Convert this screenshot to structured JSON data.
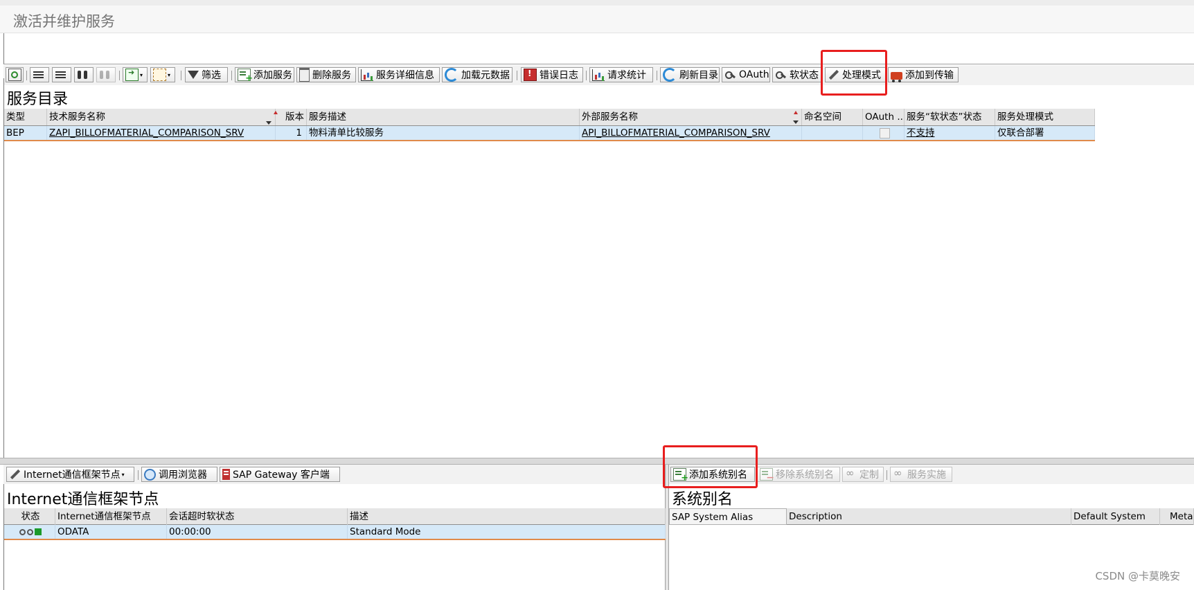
{
  "window": {
    "title": "激活并维护服务"
  },
  "toolbar": {
    "filter": "筛选",
    "add_service": "添加服务",
    "delete_service": "删除服务",
    "service_details": "服务详细信息",
    "load_metadata": "加载元数据",
    "error_log": "错误日志",
    "request_stats": "请求统计",
    "refresh_catalog": "刷新目录",
    "oauth": "OAuth",
    "soft_state": "软状态",
    "processing_mode": "处理模式",
    "add_to_transport": "添加到传输"
  },
  "catalog": {
    "title": "服务目录",
    "columns": [
      "类型",
      "技术服务名称",
      "版本",
      "服务描述",
      "外部服务名称",
      "命名空间",
      "OAuth ...",
      "服务“软状态”状态",
      "服务处理模式"
    ],
    "rows": [
      {
        "type": "BEP",
        "tech_name": "ZAPI_BILLOFMATERIAL_COMPARISON_SRV",
        "version": "1",
        "description": "物料清单比较服务",
        "external_name": "API_BILLOFMATERIAL_COMPARISON_SRV",
        "namespace": "",
        "soft_state": "不支持",
        "processing_mode": "仅联合部署"
      }
    ]
  },
  "icf": {
    "toolbar": {
      "icf_node": "Internet通信框架节点",
      "browser": "调用浏览器",
      "gateway_client": "SAP Gateway 客户端"
    },
    "title": "Internet通信框架节点",
    "columns": [
      "状态",
      "Internet通信框架节点",
      "会话超时软状态",
      "描述"
    ],
    "rows": [
      {
        "node": "ODATA",
        "timeout": "00:00:00",
        "description": "Standard Mode"
      }
    ]
  },
  "alias": {
    "toolbar": {
      "add_alias": "添加系统别名",
      "remove_alias": "移除系统别名",
      "customize": "定制",
      "implementation": "服务实施"
    },
    "title": "系统别名",
    "columns": [
      "SAP System Alias",
      "Description",
      "Default System",
      "Metada"
    ]
  },
  "watermark": "CSDN @卡莫晚安",
  "colors": {
    "highlight": "#e81e1e",
    "row_selected": "#d6e9f8",
    "status_green": "#1a9a2a"
  }
}
